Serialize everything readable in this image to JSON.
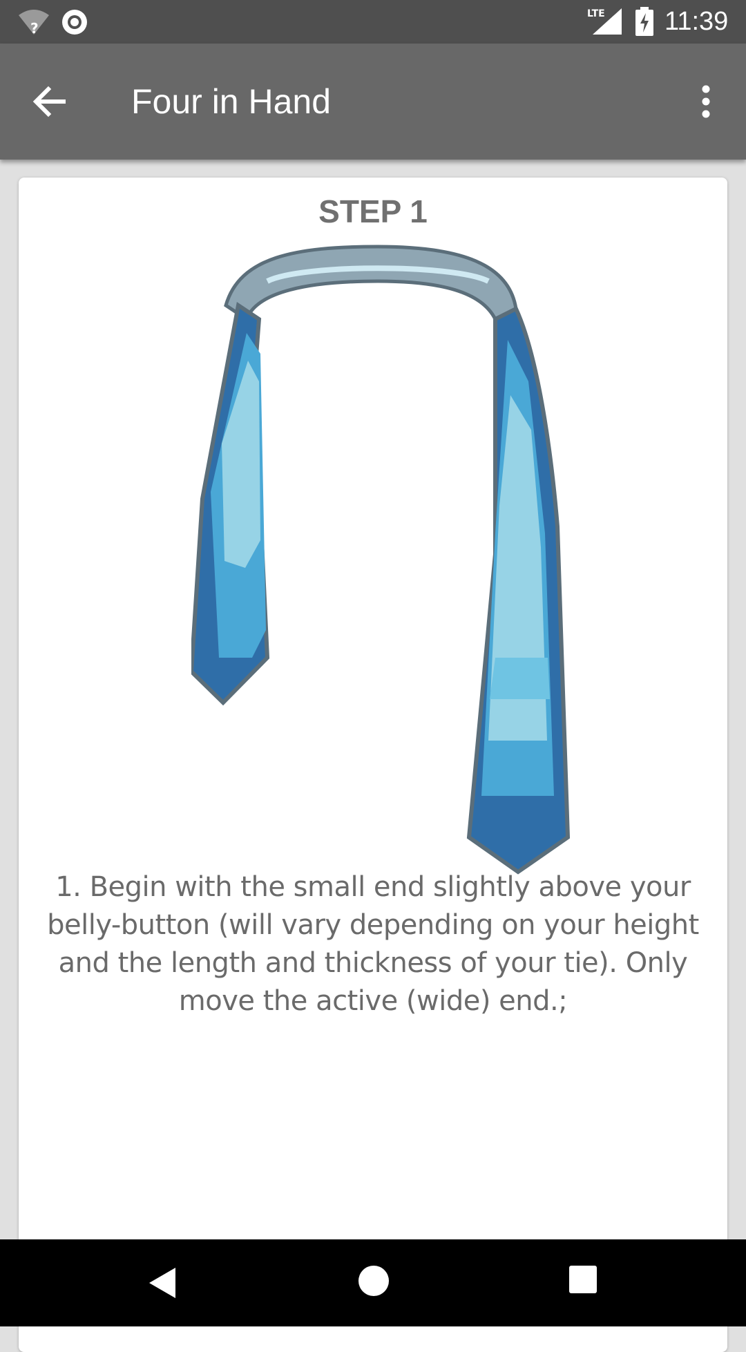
{
  "status_bar": {
    "time": "11:39",
    "network_label": "LTE",
    "icons": [
      "wifi-unknown-icon",
      "sync-circle-icon",
      "lte-signal-icon",
      "battery-charging-icon"
    ]
  },
  "app_bar": {
    "title": "Four in Hand",
    "back_icon": "arrow-left-icon",
    "menu_icon": "more-vertical-icon",
    "background": "#686868"
  },
  "step": {
    "title": "STEP 1",
    "illustration": "necktie-draped-icon",
    "instruction": "1. Begin with the small end slightly above your belly-button (will vary depending on your height and the length and thickness of your tie). Only move the active (wide) end.;"
  },
  "nav_bar": {
    "icons": [
      "nav-back-icon",
      "nav-home-icon",
      "nav-recents-icon"
    ]
  },
  "colors": {
    "status_bar": "#4f4f4f",
    "page_background": "#e0e0e0",
    "tie_light": "#97d3e6",
    "tie_mid": "#4aa8d6",
    "tie_dark": "#2f6ea8",
    "tie_outline": "#5b6e7a"
  }
}
